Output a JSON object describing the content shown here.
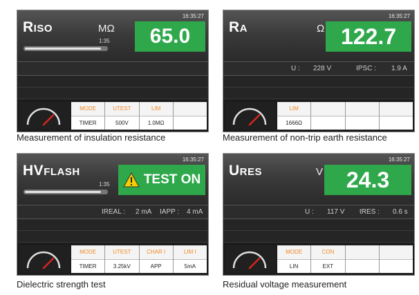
{
  "panels": [
    {
      "clock": "16:35:27",
      "title_big": "R",
      "title_small": "ISO",
      "unit": "MΩ",
      "reading": "65.0",
      "bar_time": "1:35",
      "info": [],
      "params": [
        {
          "header": "MODE",
          "value": "TIMER"
        },
        {
          "header": "UTEST",
          "value": "500V"
        },
        {
          "header": "LIM",
          "value": "1.0MΩ"
        },
        {
          "header": "",
          "value": ""
        }
      ],
      "caption": "Measurement of insulation resistance"
    },
    {
      "clock": "16:35:27",
      "title_big": "R",
      "title_small": "A",
      "unit": "Ω",
      "reading": "122.7",
      "bar_time": "",
      "info": [
        {
          "label": "U :",
          "value": "228 V"
        },
        {
          "label": "IPSC :",
          "value": "1.9 A"
        }
      ],
      "params": [
        {
          "header": "LIM",
          "value": "1666Ω"
        },
        {
          "header": "",
          "value": ""
        },
        {
          "header": "",
          "value": ""
        },
        {
          "header": "",
          "value": ""
        }
      ],
      "caption": "Measurement of non-trip earth resistance"
    },
    {
      "clock": "16:35:27",
      "title_big": "HV",
      "title_small": "FLASH",
      "unit": "",
      "reading": "TEST ON",
      "bar_time": "1:35",
      "info": [
        {
          "label": "IREAL :",
          "value": "2 mA"
        },
        {
          "label": "IAPP :",
          "value": "4 mA"
        }
      ],
      "params": [
        {
          "header": "MODE",
          "value": "TIMER"
        },
        {
          "header": "UTEST",
          "value": "3.25kV"
        },
        {
          "header": "CHAR I",
          "value": "APP"
        },
        {
          "header": "LIM I",
          "value": "5mA"
        }
      ],
      "caption": "Dielectric strength test"
    },
    {
      "clock": "16:35:27",
      "title_big": "U",
      "title_small": "RES",
      "unit": "V",
      "reading": "24.3",
      "bar_time": "",
      "info": [
        {
          "label": "U :",
          "value": "117 V"
        },
        {
          "label": "tRES :",
          "value": "0.6 s"
        }
      ],
      "params": [
        {
          "header": "MODE",
          "value": "LIN"
        },
        {
          "header": "CON",
          "value": "EXT"
        },
        {
          "header": "",
          "value": ""
        },
        {
          "header": "",
          "value": ""
        }
      ],
      "caption": "Residual voltage measurement"
    }
  ],
  "colors": {
    "accent_green": "#2ea84a",
    "param_header": "#f08a24",
    "warning_yellow": "#f5d000"
  }
}
